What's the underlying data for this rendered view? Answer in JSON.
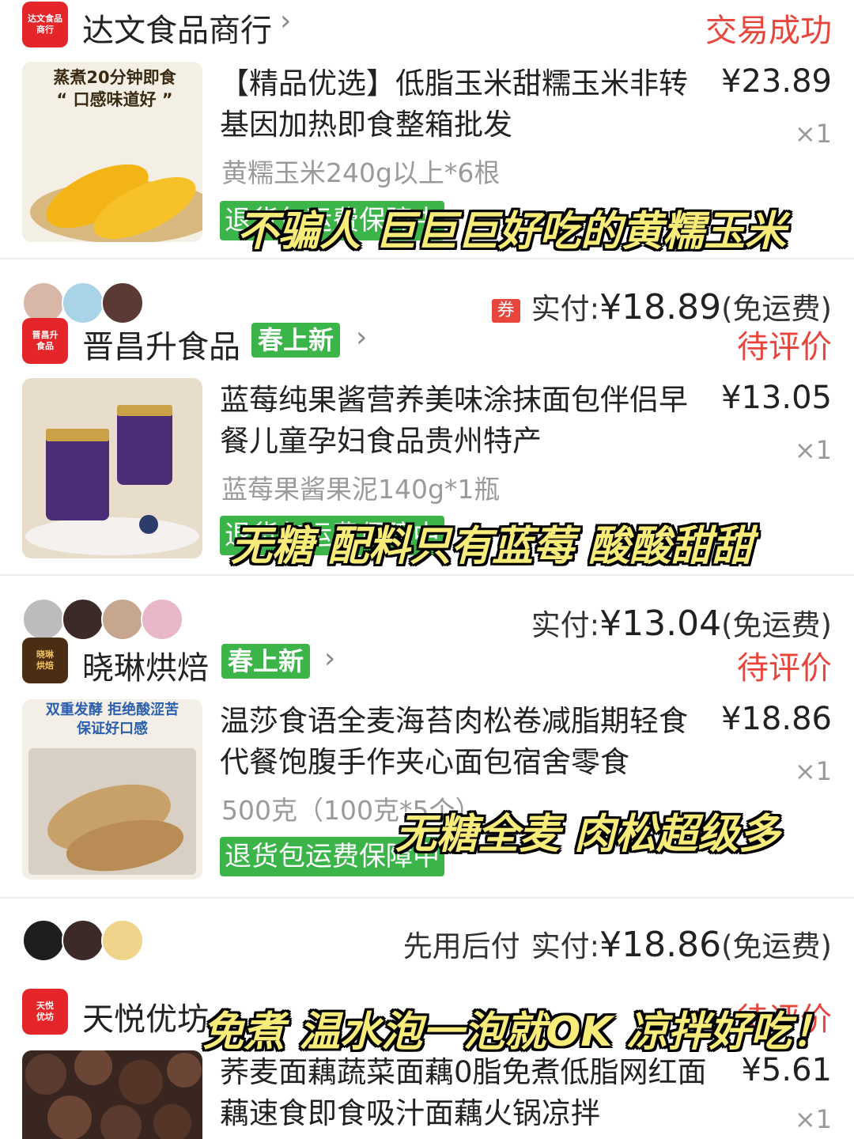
{
  "orders": [
    {
      "shop_logo": "达文食品\n商行",
      "shop_name": "达文食品商行",
      "status": "交易成功",
      "product": {
        "title": "【精品优选】低脂玉米甜糯玉米非转基因加热即食整箱批发",
        "spec": "黄糯玉米240g以上*6根",
        "price": "¥23.89",
        "qty": "×1",
        "thumb_text": "蒸煮20分钟即食\n“ 口感味道好 ”"
      },
      "guarantee": "退货包运费保障中",
      "caption": "不骗人 巨巨巨好吃的黄糯玉米"
    },
    {
      "shop_logo": "晋昌升\n食品",
      "shop_name": "晋昌升食品",
      "badge": "春上新",
      "coupon": "券",
      "paid_label": "实付:",
      "paid_amount": "¥18.89",
      "shipping": "(免运费)",
      "status": "待评价",
      "product": {
        "title": "蓝莓纯果酱营养美味涂抹面包伴侣早餐儿童孕妇食品贵州特产",
        "spec": "蓝莓果酱果泥140g*1瓶",
        "price": "¥13.05",
        "qty": "×1"
      },
      "guarantee": "退货包运费保障中",
      "caption": "无糖 配料只有蓝莓 酸酸甜甜"
    },
    {
      "shop_logo": "晓琳\n烘焙",
      "shop_name": "晓琳烘焙",
      "badge": "春上新",
      "paid_label": "实付:",
      "paid_amount": "¥13.04",
      "shipping": "(免运费)",
      "status": "待评价",
      "product": {
        "title": "温莎食语全麦海苔肉松卷减脂期轻食代餐饱腹手作夹心面包宿舍零食",
        "spec": "500克（100克*5个）",
        "price": "¥18.86",
        "qty": "×1",
        "thumb_text": "双重发酵 拒绝酸涩苦\n保证好口感"
      },
      "guarantee": "退货包运费保障中",
      "caption": "无糖全麦 肉松超级多"
    },
    {
      "shop_logo": "天悦\n优坊",
      "shop_name": "天悦优坊",
      "paylater": "先用后付",
      "paid_label": "实付:",
      "paid_amount": "¥18.86",
      "shipping": "(免运费)",
      "status": "待评价",
      "product": {
        "title": "荞麦面藕蔬菜面藕0脂免煮低脂网红面藕速食即食吸汁面藕火锅凉拌",
        "price": "¥5.61",
        "qty": "×1"
      },
      "caption": "免煮 温水泡一泡就OK 凉拌好吃！"
    }
  ]
}
